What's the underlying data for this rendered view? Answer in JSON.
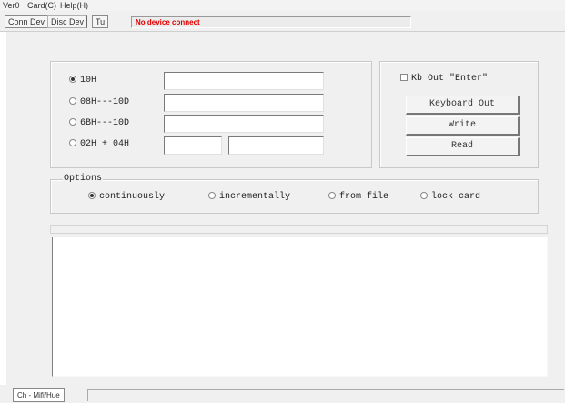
{
  "menu": [
    "Ver0",
    "Card(C)",
    "Help(H)"
  ],
  "toolbar": {
    "conn_label": "Conn Dev",
    "disc_label": "Disc Dev",
    "extra_label": "Tu",
    "status_text": "No device connect"
  },
  "formats": [
    {
      "label": "10H",
      "selected": true
    },
    {
      "label": "08H---10D",
      "selected": false
    },
    {
      "label": "6BH---10D",
      "selected": false
    },
    {
      "label": "02H + 04H",
      "selected": false
    }
  ],
  "side": {
    "kb_out_enter_label": "Kb Out \"Enter\"",
    "keyboard_out_label": "Keyboard Out",
    "write_label": "Write",
    "read_label": "Read"
  },
  "options": {
    "legend": "Options",
    "items": [
      {
        "label": "continuously",
        "selected": true
      },
      {
        "label": "incrementally",
        "selected": false
      },
      {
        "label": "from file",
        "selected": false
      },
      {
        "label": "lock card",
        "selected": false
      }
    ]
  },
  "bottom": {
    "tab_label": "Ch - Mifi/Hue"
  },
  "colors": {
    "status_text": "#e00000",
    "panel": "#f0f0f0"
  }
}
